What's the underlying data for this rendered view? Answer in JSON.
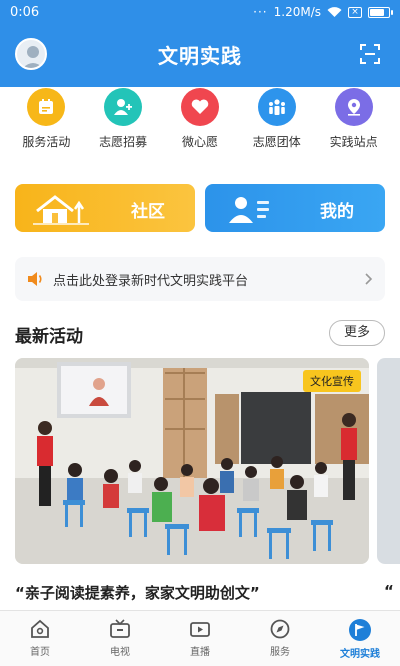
{
  "status_bar": {
    "time": "0:06",
    "network_speed": "1.20M/s"
  },
  "header": {
    "title": "文明实践"
  },
  "quick_icons": [
    {
      "label": "服务活动",
      "icon": "calendar-icon",
      "color": "#f7b718"
    },
    {
      "label": "志愿招募",
      "icon": "add-user-icon",
      "color": "#23c4b8"
    },
    {
      "label": "微心愿",
      "icon": "heart-icon",
      "color": "#f0464f"
    },
    {
      "label": "志愿团体",
      "icon": "group-icon",
      "color": "#2d94ec"
    },
    {
      "label": "实践站点",
      "icon": "location-pin-icon",
      "color": "#7b6de6"
    }
  ],
  "big_buttons": {
    "community": "社区",
    "mine": "我的"
  },
  "notice": {
    "text": "点击此处登录新时代文明实践平台"
  },
  "latest": {
    "title": "最新活动",
    "more": "更多"
  },
  "activity": {
    "tag": "文化宣传",
    "title": "“亲子阅读提素养，家家文明助创文”",
    "next_title_fragment": "“"
  },
  "bottom_nav": [
    {
      "label": "首页",
      "icon": "home-icon"
    },
    {
      "label": "电视",
      "icon": "tv-icon"
    },
    {
      "label": "直播",
      "icon": "live-video-icon"
    },
    {
      "label": "服务",
      "icon": "compass-icon"
    },
    {
      "label": "文明实践",
      "icon": "flag-icon",
      "active": true
    }
  ],
  "colors": {
    "primary": "#2f8fe8",
    "community": "#f8b41a",
    "active_nav": "#1e7fd8"
  }
}
